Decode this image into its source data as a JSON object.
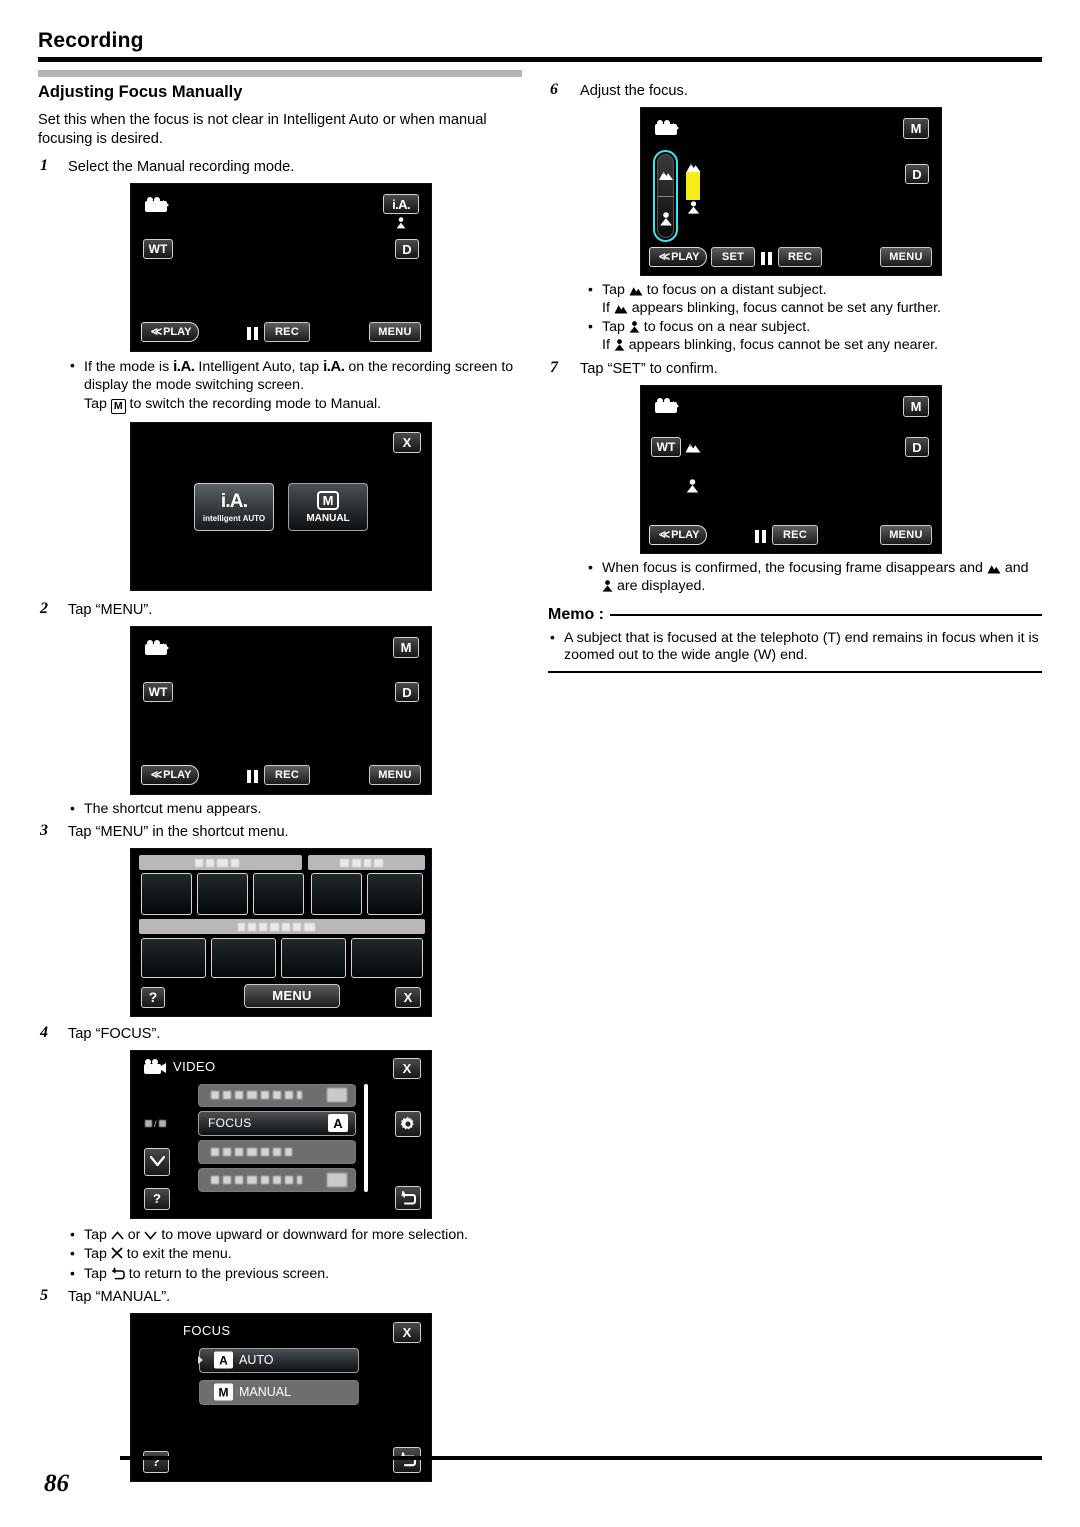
{
  "header": {
    "section": "Recording"
  },
  "page_number": "86",
  "left": {
    "title": "Adjusting Focus Manually",
    "intro": "Set this when the focus is not clear in Intelligent Auto or when manual focusing is desired.",
    "steps": [
      {
        "num": "1",
        "text": "Select the Manual recording mode."
      },
      {
        "num": "2",
        "text": "Tap “MENU”."
      },
      {
        "num": "3",
        "text": "Tap “MENU” in the shortcut menu."
      },
      {
        "num": "4",
        "text": "Tap “FOCUS”."
      },
      {
        "num": "5",
        "text": "Tap “MANUAL”."
      }
    ],
    "note_mode_1a": "If the mode is",
    "note_mode_1b": "Intelligent Auto, tap",
    "note_mode_1c": "on the recording screen to display the mode switching screen.",
    "note_mode_2a": "Tap",
    "note_mode_2b": "to switch the recording mode to Manual.",
    "note_shortcut": "The shortcut menu appears.",
    "bullets_after_focus": [
      {
        "a": "Tap",
        "b": "or",
        "c": "to move upward or downward for more selection."
      },
      {
        "a": "Tap",
        "b": "to exit the menu."
      },
      {
        "a": "Tap",
        "b": "to return to the previous screen."
      }
    ]
  },
  "right": {
    "steps": [
      {
        "num": "6",
        "text": "Adjust the focus."
      },
      {
        "num": "7",
        "text": "Tap “SET” to confirm."
      }
    ],
    "bullets_focus": [
      {
        "pre": "Tap",
        "post": "to focus on a distant subject.",
        "sub_pre": "If",
        "sub_post": "appears blinking, focus cannot be set any further."
      },
      {
        "pre": "Tap",
        "post": "to focus on a near subject.",
        "sub_pre": "If",
        "sub_post": "appears blinking, focus cannot be set any nearer."
      }
    ],
    "bullet_confirm_a": "When focus is confirmed, the focusing frame disappears and",
    "bullet_confirm_b": "and",
    "bullet_confirm_c": "are displayed.",
    "memo_label": "Memo :",
    "memo_text": "A subject that is focused at the telephoto (T) end remains in focus when it is zoomed out to the wide angle (W) end."
  },
  "screens": {
    "rec_ia": {
      "name": "recording-screen-intelligent-auto",
      "mode_tag": "i.A.",
      "zoom_tag": "WT",
      "d_tag": "D",
      "play": "PLAY",
      "rec": "REC",
      "menu": "MENU"
    },
    "mode_switch": {
      "name": "mode-switching-screen",
      "ia_big": "i.A.",
      "ia_sub": "intelligent AUTO",
      "manual_badge": "M",
      "manual_label": "MANUAL",
      "close": "X"
    },
    "rec_manual": {
      "name": "recording-screen-manual",
      "mode_tag": "M",
      "zoom_tag": "WT",
      "d_tag": "D",
      "play": "PLAY",
      "rec": "REC",
      "menu": "MENU"
    },
    "shortcut": {
      "name": "shortcut-menu-screen",
      "menu": "MENU",
      "help": "?",
      "close": "X"
    },
    "video_menu": {
      "name": "video-menu-screen",
      "title": "VIDEO",
      "focus_row": "FOCUS",
      "focus_badge": "A",
      "close": "X",
      "gear": "gear",
      "down": "v",
      "help": "?",
      "back": "back"
    },
    "focus_menu": {
      "name": "focus-setting-screen",
      "title": "FOCUS",
      "auto_badge": "A",
      "auto_label": "AUTO",
      "manual_badge": "M",
      "manual_label": "MANUAL",
      "close": "X",
      "help": "?",
      "back": "back"
    },
    "focus_adjust": {
      "name": "focus-adjust-screen",
      "mode_tag": "M",
      "d_tag": "D",
      "play": "PLAY",
      "set": "SET",
      "rec": "REC",
      "menu": "MENU"
    },
    "focus_confirmed": {
      "name": "focus-confirmed-screen",
      "mode_tag": "M",
      "zoom_tag": "WT",
      "d_tag": "D",
      "play": "PLAY",
      "rec": "REC",
      "menu": "MENU"
    }
  },
  "colors": {
    "slider_highlight": "#35e8f0",
    "slider_bar": "#f5ee16",
    "header_rule": "#000000",
    "section_rule": "#b3b3b3"
  }
}
